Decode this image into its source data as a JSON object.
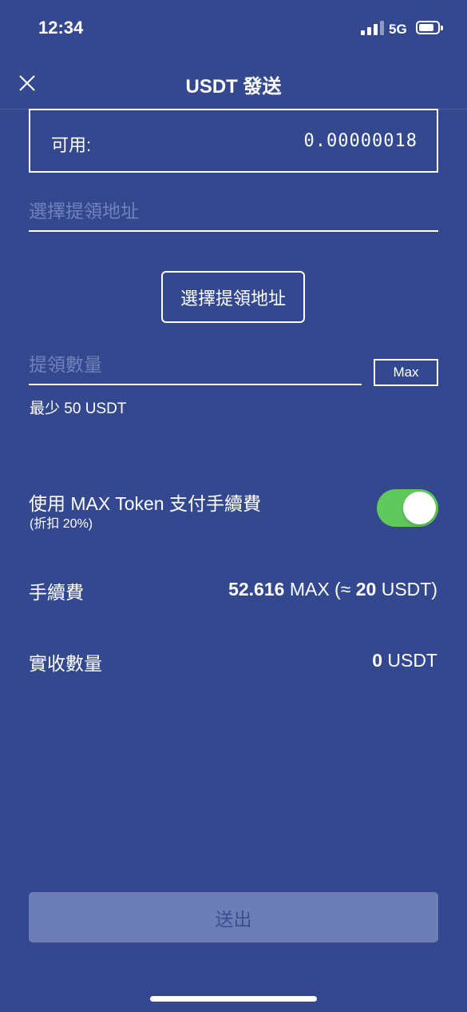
{
  "status_bar": {
    "time": "12:34",
    "network": "5G"
  },
  "header": {
    "title": "USDT 發送",
    "close_icon": "close-icon"
  },
  "balance": {
    "label": "可用:",
    "value": "0.00000018"
  },
  "address": {
    "placeholder": "選擇提領地址",
    "value": "",
    "select_button_label": "選擇提領地址"
  },
  "amount": {
    "placeholder": "提領數量",
    "value": "",
    "max_label": "Max",
    "min_note": "最少 50 USDT"
  },
  "max_token_fee": {
    "title": "使用 MAX Token 支付手續費",
    "subtitle": "(折扣 20%)",
    "enabled": true
  },
  "fee": {
    "label": "手續費",
    "amount": "52.616",
    "unit": "MAX",
    "approx_prefix": "(≈",
    "approx_amount": "20",
    "approx_suffix": "USDT)"
  },
  "received": {
    "label": "實收數量",
    "amount": "0",
    "unit": "USDT"
  },
  "submit": {
    "label": "送出"
  },
  "colors": {
    "background": "#33488e",
    "toggle_on": "#5fc95d",
    "submit_disabled": "#6d7db6",
    "placeholder": "#7081bb"
  }
}
